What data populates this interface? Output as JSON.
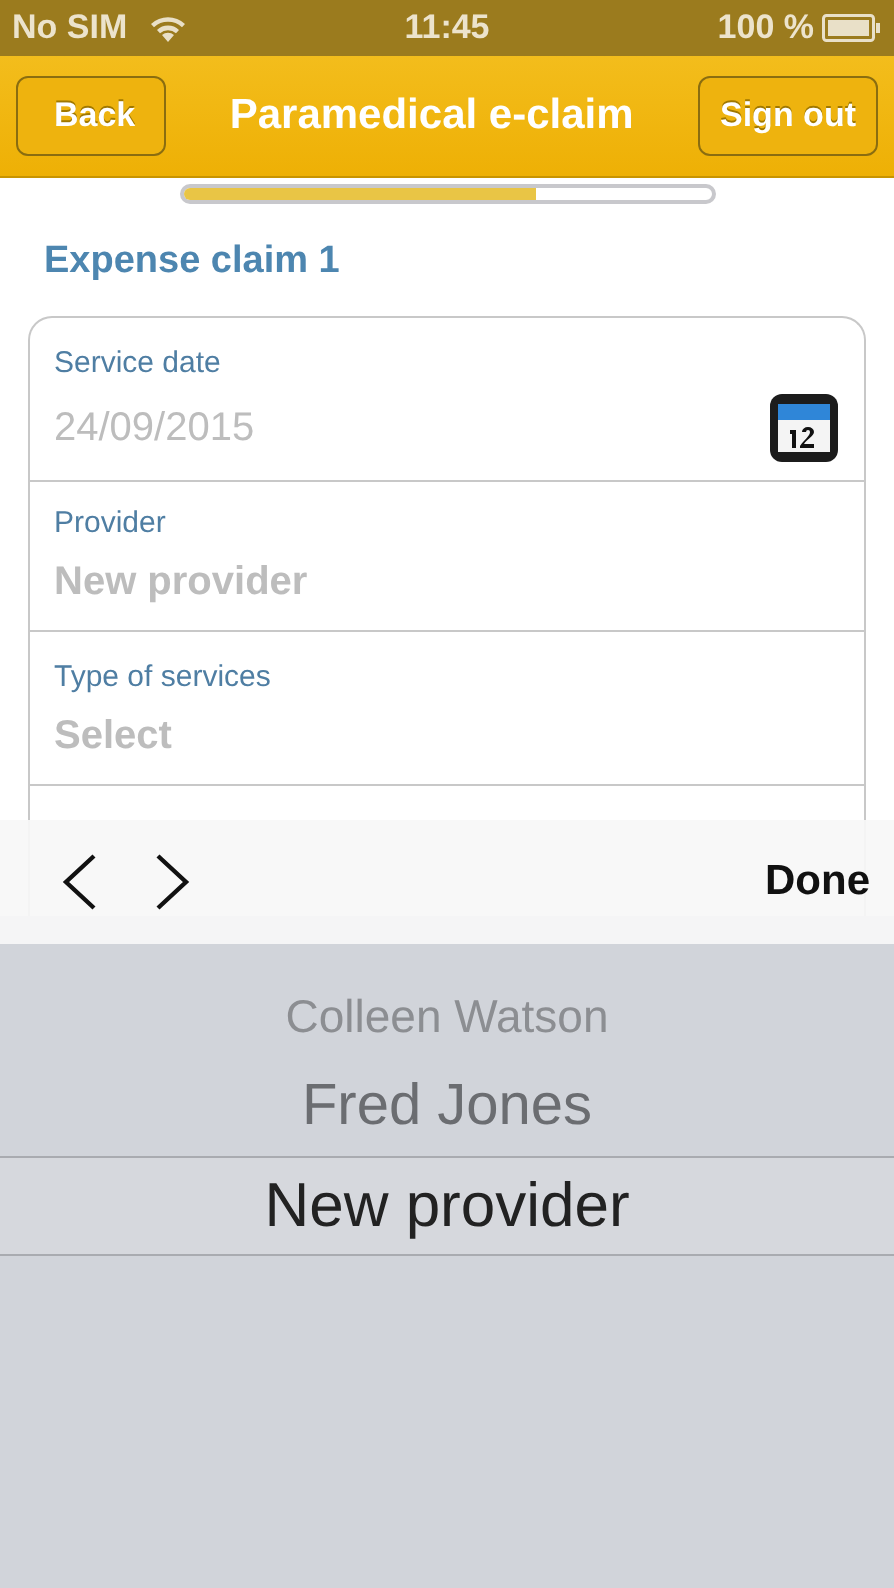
{
  "status_bar": {
    "carrier": "No SIM",
    "time": "11:45",
    "battery": "100 %"
  },
  "nav_bar": {
    "back": "Back",
    "title": "Paramedical e-claim",
    "action": "Sign out"
  },
  "progress": {
    "level": 0.67
  },
  "section_title": "Expense claim 1",
  "fields": [
    {
      "label": "Service date",
      "placeholder": "24/09/2015",
      "kind": "date"
    },
    {
      "label": "Provider",
      "placeholder": "New provider",
      "kind": "select"
    },
    {
      "label": "Type of services",
      "placeholder": "Select",
      "kind": "select"
    }
  ],
  "toolbar": {
    "done": "Done"
  },
  "picker": [
    {
      "label": "Colleen Watson",
      "selected": false
    },
    {
      "label": "Fred Jones",
      "selected": false
    },
    {
      "label": "New provider",
      "selected": true
    }
  ]
}
